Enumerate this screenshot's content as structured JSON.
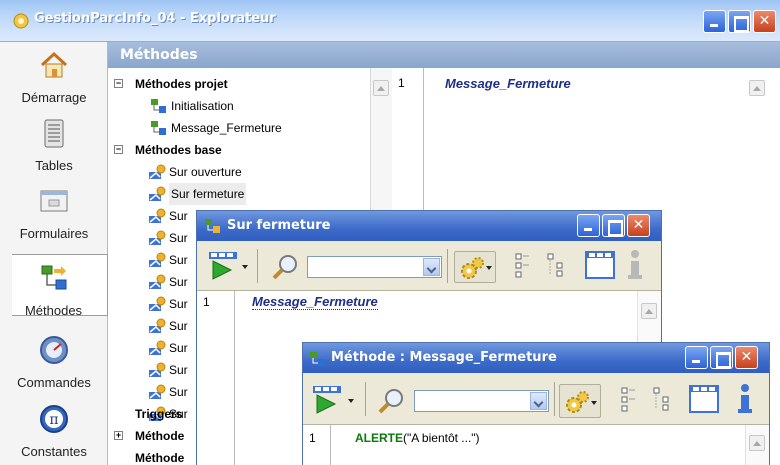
{
  "window": {
    "title": "GestionParcInfo_04 - Explorateur"
  },
  "sidebar": {
    "items": [
      {
        "label": "Démarrage",
        "icon": "house-icon"
      },
      {
        "label": "Tables",
        "icon": "table-icon"
      },
      {
        "label": "Formulaires",
        "icon": "form-icon"
      },
      {
        "label": "Méthodes",
        "icon": "method-icon",
        "active": true
      },
      {
        "label": "Commandes",
        "icon": "command-icon"
      },
      {
        "label": "Constantes",
        "icon": "pi-icon"
      }
    ]
  },
  "section": {
    "title": "Méthodes"
  },
  "tree": {
    "projet_group": "Méthodes projet",
    "projet_items": [
      "Initialisation",
      "Message_Fermeture"
    ],
    "base_group": "Méthodes base",
    "base_items": [
      "Sur ouverture",
      "Sur fermeture",
      "Sur",
      "Sur",
      "Sur",
      "Sur",
      "Sur",
      "Sur",
      "Sur",
      "Sur",
      "Sur",
      "Sur"
    ],
    "triggers": "Triggers",
    "methode_1": "Méthode",
    "methode_2": "Méthode"
  },
  "editor": {
    "line_number": "1",
    "code": "Message_Fermeture"
  },
  "window_sur_fermeture": {
    "title": "Sur fermeture",
    "line_number": "1",
    "code": "Message_Fermeture",
    "search_value": ""
  },
  "window_message": {
    "title": "Méthode : Message_Fermeture",
    "line_number": "1",
    "code_keyword": "ALERTE",
    "code_args": "(\"A bientôt ...\")",
    "search_value": ""
  },
  "colors": {
    "title_bar": "#2f5fc0",
    "close_button": "#c7401d",
    "code_blue": "#1d2e8c",
    "code_green": "#0b7a0b"
  }
}
